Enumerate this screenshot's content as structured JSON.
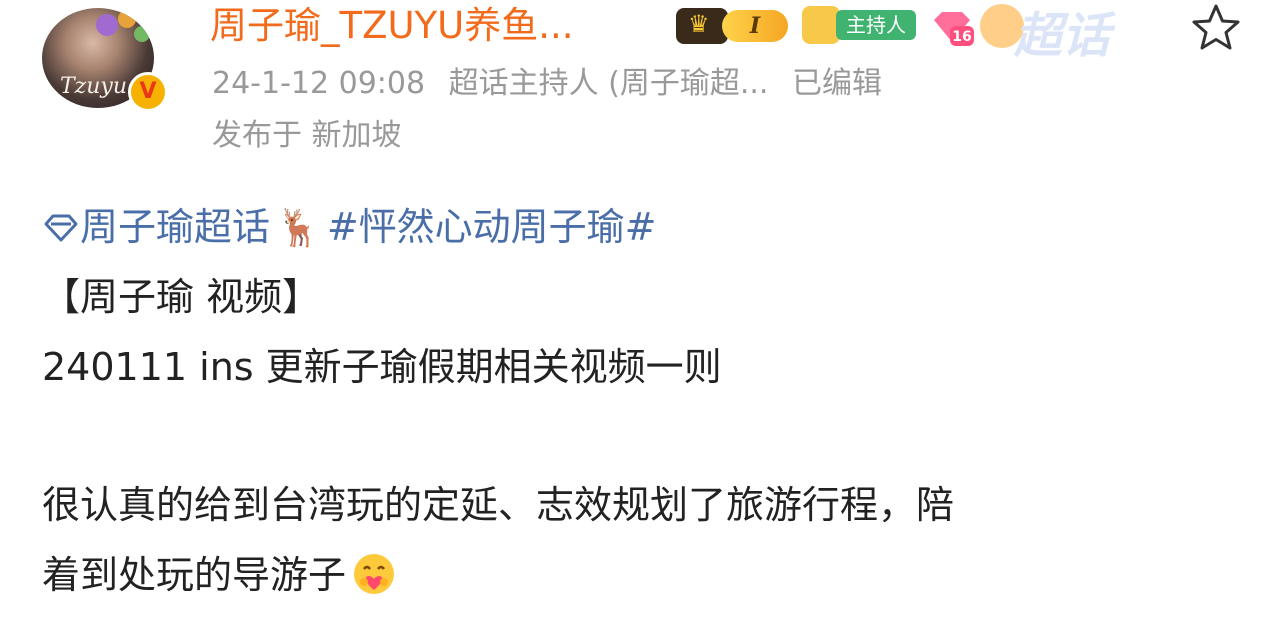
{
  "header": {
    "username": "周子瑜_TZUYU养鱼...",
    "avatar_text": "Tzuyu",
    "verified_mark": "V",
    "level_badge": "I",
    "host_badge": "主持人",
    "level_16": "16",
    "chaohua_watermark": "超话",
    "timestamp": "24-1-12 09:08",
    "role": "超话主持人 (周子瑜超...",
    "edited": "已编辑",
    "location": "发布于 新加坡"
  },
  "post": {
    "topic_link": "周子瑜超话",
    "deer_emoji": "🦌",
    "hashtag": "#怦然心动周子瑜#",
    "title_line": "【周子瑜 视频】",
    "date_line": "240111 ins 更新子瑜假期相关视频一则",
    "paragraph_line1": "很认真的给到台湾玩的定延、志效规划了旅游行程，陪",
    "paragraph_line2": "着到处玩的导游子"
  },
  "icons": {
    "star": "star-icon",
    "super-topic": "diamond-icon",
    "hug": "hug-emoji-icon"
  },
  "colors": {
    "username": "#f26a1b",
    "meta": "#999999",
    "link": "#4a6ea8",
    "text": "#222222"
  }
}
